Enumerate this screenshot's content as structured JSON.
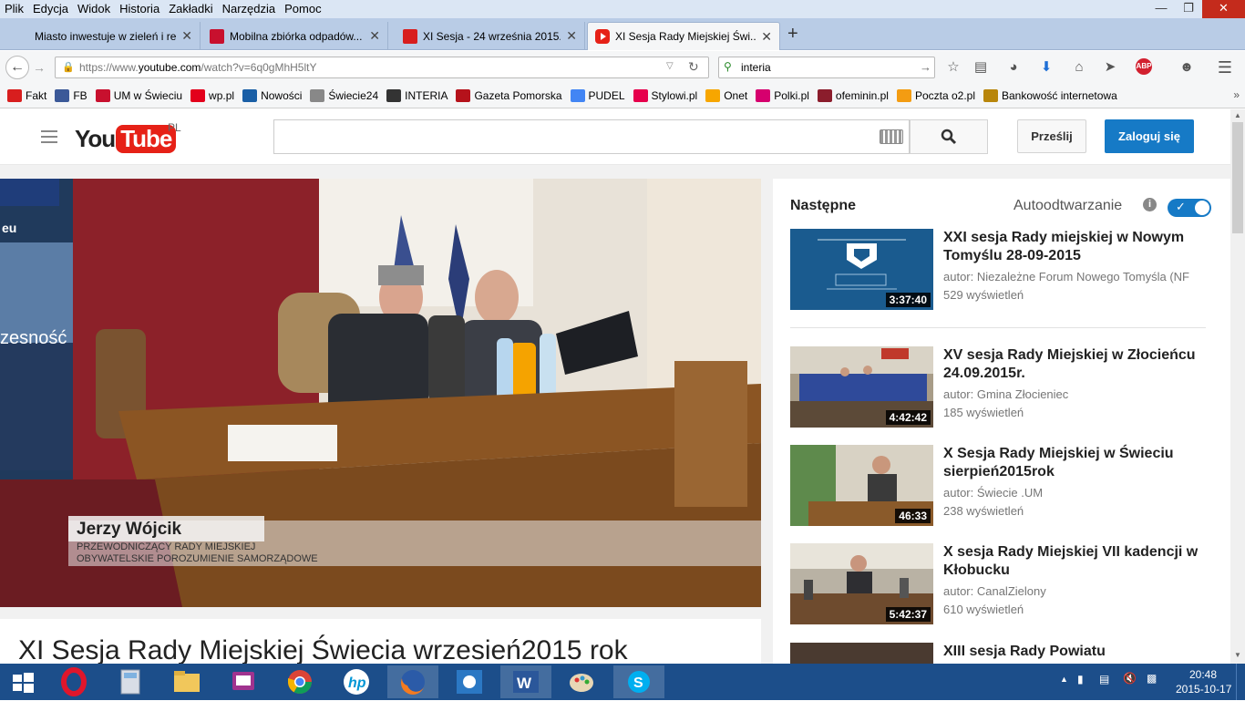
{
  "menubar": {
    "items": [
      "Plik",
      "Edycja",
      "Widok",
      "Historia",
      "Zakładki",
      "Narzędzia",
      "Pomoc"
    ]
  },
  "tabs": [
    {
      "label": "Miasto inwestuje w zieleń i rek..."
    },
    {
      "label": "Mobilna zbiórka odpadów..."
    },
    {
      "label": "XI Sesja - 24 września 2015..."
    },
    {
      "label": "XI Sesja Rady Miejskiej Świ..."
    }
  ],
  "new_tab_label": "+",
  "nav": {
    "url_prefix": "https://www.",
    "url_domain": "youtube.com",
    "url_path": "/watch?v=6q0gMhH5ltY",
    "search_value": "interia"
  },
  "bookmarks": [
    {
      "label": "Fakt",
      "color": "#d81e1e"
    },
    {
      "label": "FB",
      "color": "#3b5998"
    },
    {
      "label": "UM w Świeciu",
      "color": "#c8102e"
    },
    {
      "label": "wp.pl",
      "color": "#e3001b"
    },
    {
      "label": "Nowości",
      "color": "#1a5fa6"
    },
    {
      "label": "Świecie24",
      "color": "#888888"
    },
    {
      "label": "INTERIA",
      "color": "#333333"
    },
    {
      "label": "Gazeta Pomorska",
      "color": "#b5121b"
    },
    {
      "label": "PUDEL",
      "color": "#4285f4"
    },
    {
      "label": "Stylowi.pl",
      "color": "#e6004c"
    },
    {
      "label": "Onet",
      "color": "#f7a600"
    },
    {
      "label": "Polki.pl",
      "color": "#d6006e"
    },
    {
      "label": "ofeminin.pl",
      "color": "#8b1d2c"
    },
    {
      "label": "Poczta o2.pl",
      "color": "#f39c12"
    },
    {
      "label": "Bankowość internetowa",
      "color": "#b8860b"
    }
  ],
  "youtube": {
    "logo_you": "You",
    "logo_tube": "Tube",
    "region": "PL",
    "search_placeholder": "",
    "upload_label": "Prześlij",
    "login_label": "Zaloguj się"
  },
  "video": {
    "lower_third_name": "Jerzy Wójcik",
    "lower_third_line1": "PRZEWODNICZĄCY RADY MIEJSKIEJ",
    "lower_third_line2": "OBYWATELSKIE POROZUMIENIE SAMORZĄDOWE",
    "banner_text1": "eu",
    "banner_text2": "zesność",
    "title": "XI Sesja Rady Miejskiej Świecia wrzesień2015 rok"
  },
  "sidebar": {
    "next_label": "Następne",
    "autoplay_label": "Autoodtwarzanie",
    "autoplay_on": true,
    "items": [
      {
        "title": "XXI sesja Rady miejskiej w Nowym Tomyślu 28-09-2015",
        "author": "autor: Niezależne Forum Nowego Tomyśla (NF",
        "views": "529 wyświetleń",
        "duration": "3:37:40"
      },
      {
        "title": "XV sesja Rady Miejskiej w Złocieńcu 24.09.2015r.",
        "author": "autor: Gmina Złocieniec",
        "views": "185 wyświetleń",
        "duration": "4:42:42"
      },
      {
        "title": "X Sesja Rady Miejskiej w Świeciu sierpień2015rok",
        "author": "autor: Świecie .UM",
        "views": "238 wyświetleń",
        "duration": "46:33"
      },
      {
        "title": "X sesja Rady Miejskiej VII kadencji w Kłobucku",
        "author": "autor: CanalZielony",
        "views": "610 wyświetleń",
        "duration": "5:42:37"
      },
      {
        "title": "XIII sesja Rady Powiatu",
        "author": "",
        "views": "",
        "duration": ""
      }
    ]
  },
  "taskbar": {
    "time": "20:48",
    "date": "2015-10-17"
  }
}
